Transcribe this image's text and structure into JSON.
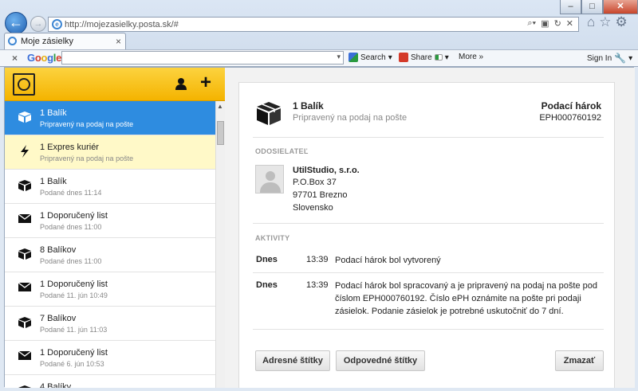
{
  "browser": {
    "url": "http://mojezasielky.posta.sk/#",
    "tab_title": "Moje zásielky",
    "close_tab_glyph": "×",
    "window_controls": {
      "minimize": "–",
      "maximize": "□",
      "close": "✕"
    },
    "nav_icons": [
      "home-icon",
      "star-icon",
      "gear-icon"
    ]
  },
  "google_toolbar": {
    "logo": "Google",
    "search_value": "",
    "search_label": "Search",
    "share_label": "Share",
    "more_label": "More »",
    "sign_in_label": "Sign In"
  },
  "sidebar": {
    "items": [
      {
        "icon": "package-icon",
        "title": "1 Balík",
        "subtitle": "Pripravený na podaj na pošte",
        "state": "selected"
      },
      {
        "icon": "lightning-icon",
        "title": "1 Expres kuriér",
        "subtitle": "Pripravený na podaj na pošte",
        "state": "highlighted"
      },
      {
        "icon": "package-icon",
        "title": "1 Balík",
        "subtitle": "Podané dnes 11:14",
        "state": "normal"
      },
      {
        "icon": "envelope-icon",
        "title": "1 Doporučený list",
        "subtitle": "Podané dnes 11:00",
        "state": "normal"
      },
      {
        "icon": "package-icon",
        "title": "8 Balíkov",
        "subtitle": "Podané dnes 11:00",
        "state": "normal"
      },
      {
        "icon": "envelope-icon",
        "title": "1 Doporučený list",
        "subtitle": "Podané 11. jún 10:49",
        "state": "normal"
      },
      {
        "icon": "package-icon",
        "title": "7 Balíkov",
        "subtitle": "Podané 11. jún 11:03",
        "state": "normal"
      },
      {
        "icon": "envelope-icon",
        "title": "1 Doporučený list",
        "subtitle": "Podané 6. jún 10:53",
        "state": "normal"
      },
      {
        "icon": "package-icon",
        "title": "4 Balíky",
        "subtitle": "",
        "state": "normal"
      }
    ]
  },
  "detail": {
    "title": "1 Balík",
    "status": "Pripravený na podaj na pošte",
    "doc_label": "Podací hárok",
    "doc_number": "EPH000760192",
    "sender_section": "ODOSIELATEĽ",
    "sender": {
      "name": "UtilStudio, s.r.o.",
      "lines": [
        "P.O.Box 37",
        "97701 Brezno",
        "Slovensko"
      ]
    },
    "activity_section": "AKTIVITY",
    "activities": [
      {
        "day": "Dnes",
        "time": "13:39",
        "text": "Podací hárok bol vytvorený"
      },
      {
        "day": "Dnes",
        "time": "13:39",
        "text": "Podací hárok bol spracovaný a je pripravený na podaj na pošte pod číslom EPH000760192. Číslo ePH oznámite na pošte pri podaji zásielok. Podanie zásielok je potrebné uskutočniť do 7 dní."
      }
    ],
    "buttons": {
      "address_labels": "Adresné štítky",
      "reply_labels": "Odpovedné štítky",
      "delete": "Zmazať"
    }
  },
  "colors": {
    "header_yellow": "#f4b300",
    "selected_blue": "#2e8ce0",
    "highlight_yellow": "#fff9c8"
  }
}
